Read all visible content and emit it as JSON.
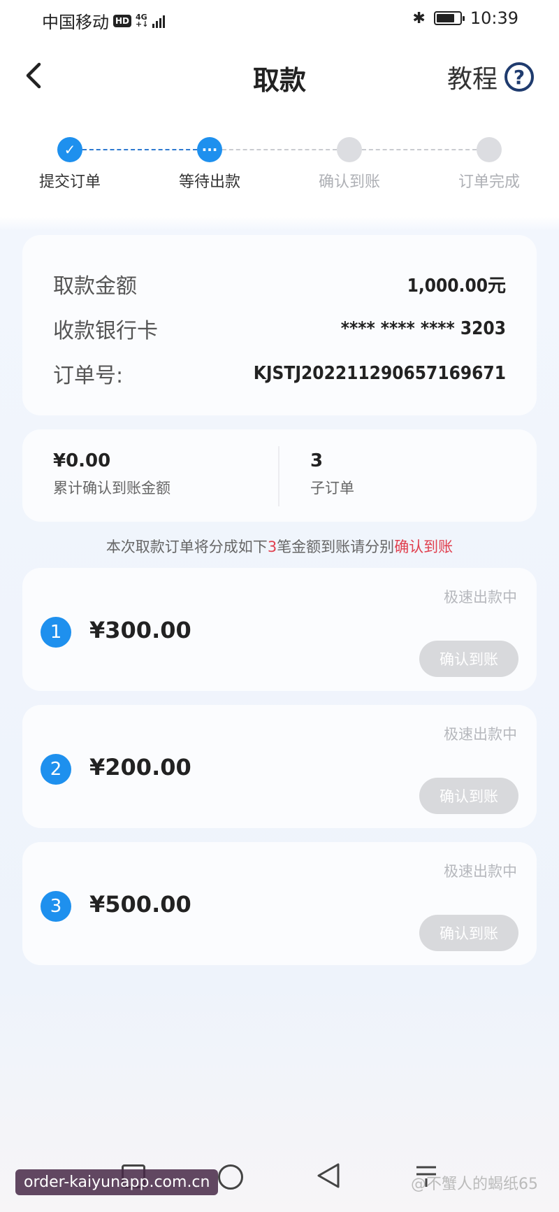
{
  "status_bar": {
    "carrier": "中国移动",
    "hd": "HD",
    "network_top": "4G",
    "network_bottom": "+↓",
    "time": "10:39",
    "battery_level": 0.8
  },
  "header": {
    "title": "取款",
    "tutorial_label": "教程",
    "help_symbol": "?"
  },
  "steps": [
    {
      "label": "提交订单",
      "state": "done"
    },
    {
      "label": "等待出款",
      "state": "active"
    },
    {
      "label": "确认到账",
      "state": "pending"
    },
    {
      "label": "订单完成",
      "state": "pending"
    }
  ],
  "withdrawal": {
    "amount_label": "取款金额",
    "amount_value": "1,000.00元",
    "card_label": "收款银行卡",
    "card_value": "**** **** **** 3203",
    "order_label": "订单号:",
    "order_value": "KJSTJ20221129065716967​1"
  },
  "summary": {
    "confirmed_value": "¥0.00",
    "confirmed_label": "累计确认到账金额",
    "sub_orders_value": "3",
    "sub_orders_label": "子订单"
  },
  "notice": {
    "prefix": "本次取款订单将分成如下",
    "count": "3",
    "middle": "笔金额到账请分别",
    "highlight": "确认到账"
  },
  "orders": [
    {
      "index": "1",
      "amount": "¥300.00",
      "status": "极速出款中",
      "button": "确认到账"
    },
    {
      "index": "2",
      "amount": "¥200.00",
      "status": "极速出款中",
      "button": "确认到账"
    },
    {
      "index": "3",
      "amount": "¥500.00",
      "status": "极速出款中",
      "button": "确认到账"
    }
  ],
  "footer": {
    "watermark": "order-kaiyunapp.com.cn",
    "weibo": "@不蟹人的蝎纸65"
  },
  "colors": {
    "accent": "#1e90ee",
    "highlight_red": "#e0404f",
    "disabled_button": "#d8d9dc"
  }
}
